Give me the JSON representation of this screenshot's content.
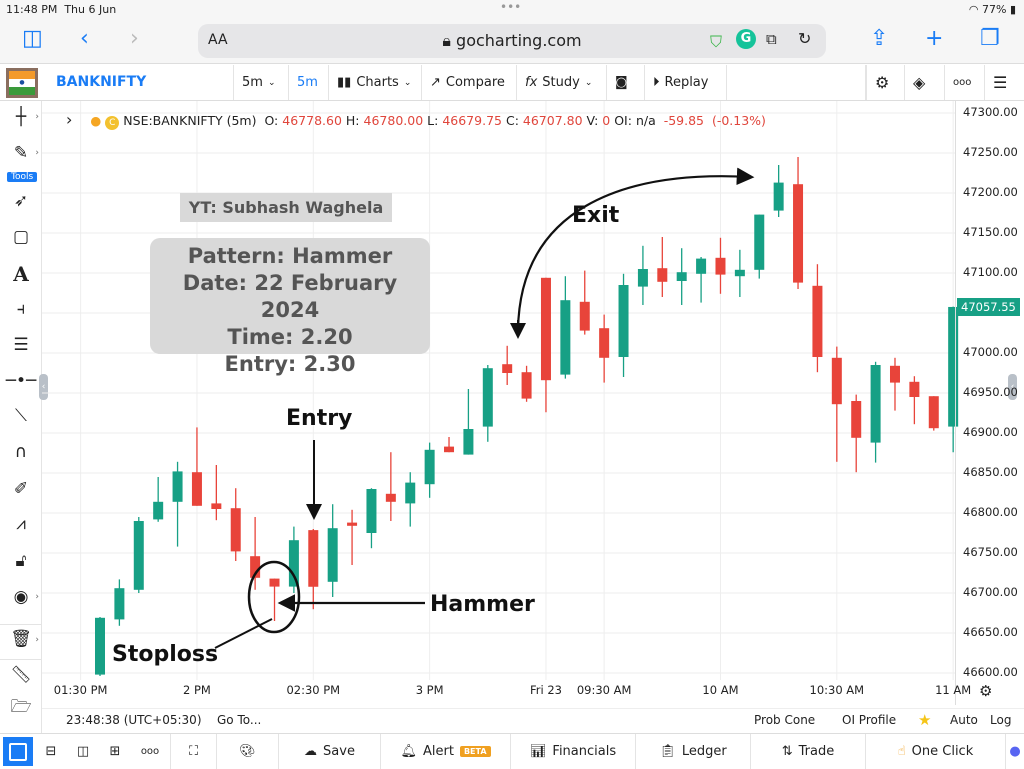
{
  "status_bar": {
    "time": "11:48 PM",
    "date": "Thu 6 Jun",
    "battery": "77%"
  },
  "browser": {
    "text_size_label": "AA",
    "url": "gocharting.com"
  },
  "toolbar": {
    "symbol": "BANKNIFTY",
    "interval_dropdown": "5m",
    "interval_active": "5m",
    "charts_label": "Charts",
    "compare_label": "Compare",
    "study_label": "Study",
    "replay_label": "Replay"
  },
  "left_tools": {
    "tools_badge": "Tools"
  },
  "info_line": {
    "symbol": "NSE:BANKNIFTY (5m)",
    "o_label": "O:",
    "o": "46778.60",
    "h_label": "H:",
    "h": "46780.00",
    "l_label": "L:",
    "l": "46679.75",
    "c_label": "C:",
    "c": "46707.80",
    "v_label": "V:",
    "v": "0",
    "oi_label": "OI:",
    "oi": "n/a",
    "change": "-59.85",
    "change_pct": "(-0.13%)"
  },
  "annotations": {
    "yt": "YT: Subhash Waghela",
    "pattern": "Pattern: Hammer",
    "date": "Date: 22 February 2024",
    "time": "Time: 2.20",
    "entry_time": "Entry: 2.30",
    "entry_label": "Entry",
    "exit_label": "Exit",
    "hammer_label": "Hammer",
    "stoploss_label": "Stoploss"
  },
  "chart_data": {
    "type": "candlestick",
    "price_ticks": [
      "47300.00",
      "47250.00",
      "47200.00",
      "47150.00",
      "47100.00",
      "47050.00",
      "47000.00",
      "46950.00",
      "46900.00",
      "46850.00",
      "46800.00",
      "46750.00",
      "46700.00",
      "46650.00",
      "46600.00"
    ],
    "ylim": [
      46600,
      47300
    ],
    "last_price": "47057.55",
    "time_labels": [
      {
        "label": "01:30 PM",
        "at_candle": -1
      },
      {
        "label": "2 PM",
        "at_candle": 5
      },
      {
        "label": "02:30 PM",
        "at_candle": 11
      },
      {
        "label": "3 PM",
        "at_candle": 17
      },
      {
        "label": "Fri 23",
        "at_candle": 23
      },
      {
        "label": "09:30 AM",
        "at_candle": 26
      },
      {
        "label": "10 AM",
        "at_candle": 32
      },
      {
        "label": "10:30 AM",
        "at_candle": 38
      },
      {
        "label": "11 AM",
        "at_candle": 44
      }
    ],
    "candles": [
      [
        46598,
        46670,
        46596,
        46669
      ],
      [
        46667,
        46717,
        46659,
        46706
      ],
      [
        46704,
        46795,
        46700,
        46790
      ],
      [
        46792,
        46845,
        46789,
        46814
      ],
      [
        46814,
        46864,
        46758,
        46852
      ],
      [
        46851,
        46907,
        46809,
        46809
      ],
      [
        46812,
        46860,
        46791,
        46805
      ],
      [
        46806,
        46831,
        46740,
        46752
      ],
      [
        46746,
        46795,
        46704,
        46719
      ],
      [
        46718,
        46718,
        46665,
        46708
      ],
      [
        46708,
        46783,
        46700,
        46766
      ],
      [
        46778.6,
        46780,
        46679.75,
        46707.8
      ],
      [
        46714,
        46811,
        46695,
        46781
      ],
      [
        46788,
        46804,
        46735,
        46784
      ],
      [
        46775,
        46831,
        46756,
        46830
      ],
      [
        46824,
        46876,
        46790,
        46814
      ],
      [
        46812,
        46851,
        46783,
        46838
      ],
      [
        46836,
        46888,
        46819,
        46879
      ],
      [
        46883,
        46895,
        46876,
        46876
      ],
      [
        46873,
        46955,
        46873,
        46905
      ],
      [
        46908,
        46985,
        46889,
        46981
      ],
      [
        46986,
        47009,
        46960,
        46975
      ],
      [
        46976,
        46984,
        46939,
        46943
      ],
      [
        47094,
        47094,
        46926,
        46966
      ],
      [
        46973,
        47096,
        46968,
        47066
      ],
      [
        47064,
        47103,
        47023,
        47028
      ],
      [
        47031,
        47048,
        46963,
        46994
      ],
      [
        46995,
        47099,
        46970,
        47085
      ],
      [
        47083,
        47134,
        47060,
        47105
      ],
      [
        47106,
        47145,
        47070,
        47089
      ],
      [
        47090,
        47131,
        47060,
        47101
      ],
      [
        47099,
        47120,
        47063,
        47118
      ],
      [
        47119,
        47144,
        47074,
        47098
      ],
      [
        47096,
        47129,
        47070,
        47104
      ],
      [
        47104,
        47173,
        47093,
        47173
      ],
      [
        47178,
        47235,
        47170,
        47213
      ],
      [
        47211,
        47245,
        47080,
        47088
      ],
      [
        47084,
        47111,
        46976,
        46995
      ],
      [
        46994,
        47008,
        46864,
        46936
      ],
      [
        46940,
        46948,
        46851,
        46894
      ],
      [
        46888,
        46989,
        46863,
        46985
      ],
      [
        46984,
        46994,
        46928,
        46963
      ],
      [
        46964,
        46971,
        46911,
        46945
      ],
      [
        46946,
        46946,
        46903,
        46906
      ],
      [
        46908,
        47058,
        46876,
        47057.55
      ]
    ],
    "candle_format": [
      "open",
      "high",
      "low",
      "close"
    ],
    "colors": {
      "up": "#17a085",
      "down": "#e8443a",
      "grid": "#eeeeee"
    }
  },
  "status_row": {
    "clock": "23:48:38 (UTC+05:30)",
    "goto": "Go To...",
    "prob_cone": "Prob Cone",
    "oi_profile": "OI Profile",
    "auto": "Auto",
    "log": "Log"
  },
  "bottom_bar": {
    "save": "Save",
    "alert": "Alert",
    "alert_badge": "BETA",
    "financials": "Financials",
    "ledger": "Ledger",
    "trade": "Trade",
    "one_click": "One Click"
  },
  "colors": {
    "accent": "#1a7cf5",
    "up": "#17a085",
    "down": "#e8443a"
  }
}
